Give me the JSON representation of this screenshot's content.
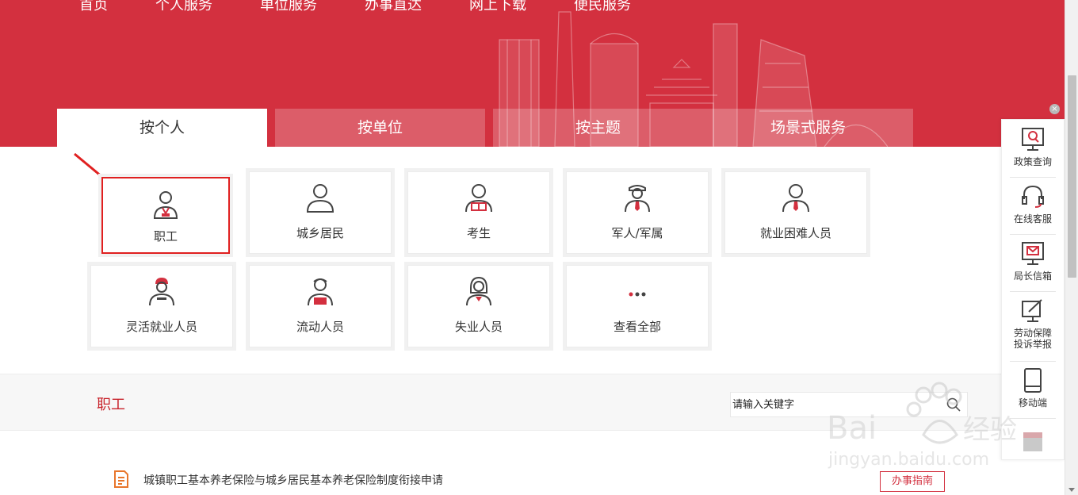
{
  "nav": [
    "首页",
    "个人服务",
    "单位服务",
    "办事直达",
    "网上下载",
    "便民服务"
  ],
  "tabs": [
    "按个人",
    "按单位",
    "按主题",
    "场景式服务"
  ],
  "audiences": [
    {
      "label": "职工",
      "icon": "worker-icon"
    },
    {
      "label": "城乡居民",
      "icon": "person-icon"
    },
    {
      "label": "考生",
      "icon": "examinee-icon"
    },
    {
      "label": "军人/军属",
      "icon": "soldier-icon"
    },
    {
      "label": "就业困难人员",
      "icon": "person-tie-icon"
    },
    {
      "label": "灵活就业人员",
      "icon": "flexible-worker-icon"
    },
    {
      "label": "流动人员",
      "icon": "mobile-worker-icon"
    },
    {
      "label": "失业人员",
      "icon": "unemployed-icon"
    },
    {
      "label": "查看全部",
      "icon": "more-dots-icon"
    }
  ],
  "selected_audience": "职工",
  "section": {
    "title": "职工",
    "search_placeholder": "请输入关键字"
  },
  "list": [
    {
      "title": "城镇职工基本养老保险与城乡居民基本养老保险制度衔接申请",
      "action": "办事指南"
    }
  ],
  "float_bar": [
    {
      "label": "政策查询",
      "icon": "policy-search-icon"
    },
    {
      "label": "在线客服",
      "icon": "headset-icon"
    },
    {
      "label": "局长信箱",
      "icon": "mailbox-icon"
    },
    {
      "label": "劳动保障投诉举报",
      "label_lines": [
        "劳动保障",
        "投诉举报"
      ],
      "icon": "complaint-icon"
    },
    {
      "label": "移动端",
      "icon": "mobile-icon"
    }
  ],
  "colors": {
    "brand_red": "#d3303f",
    "highlight_red": "#e02020",
    "section_title_red": "#c8232b"
  }
}
